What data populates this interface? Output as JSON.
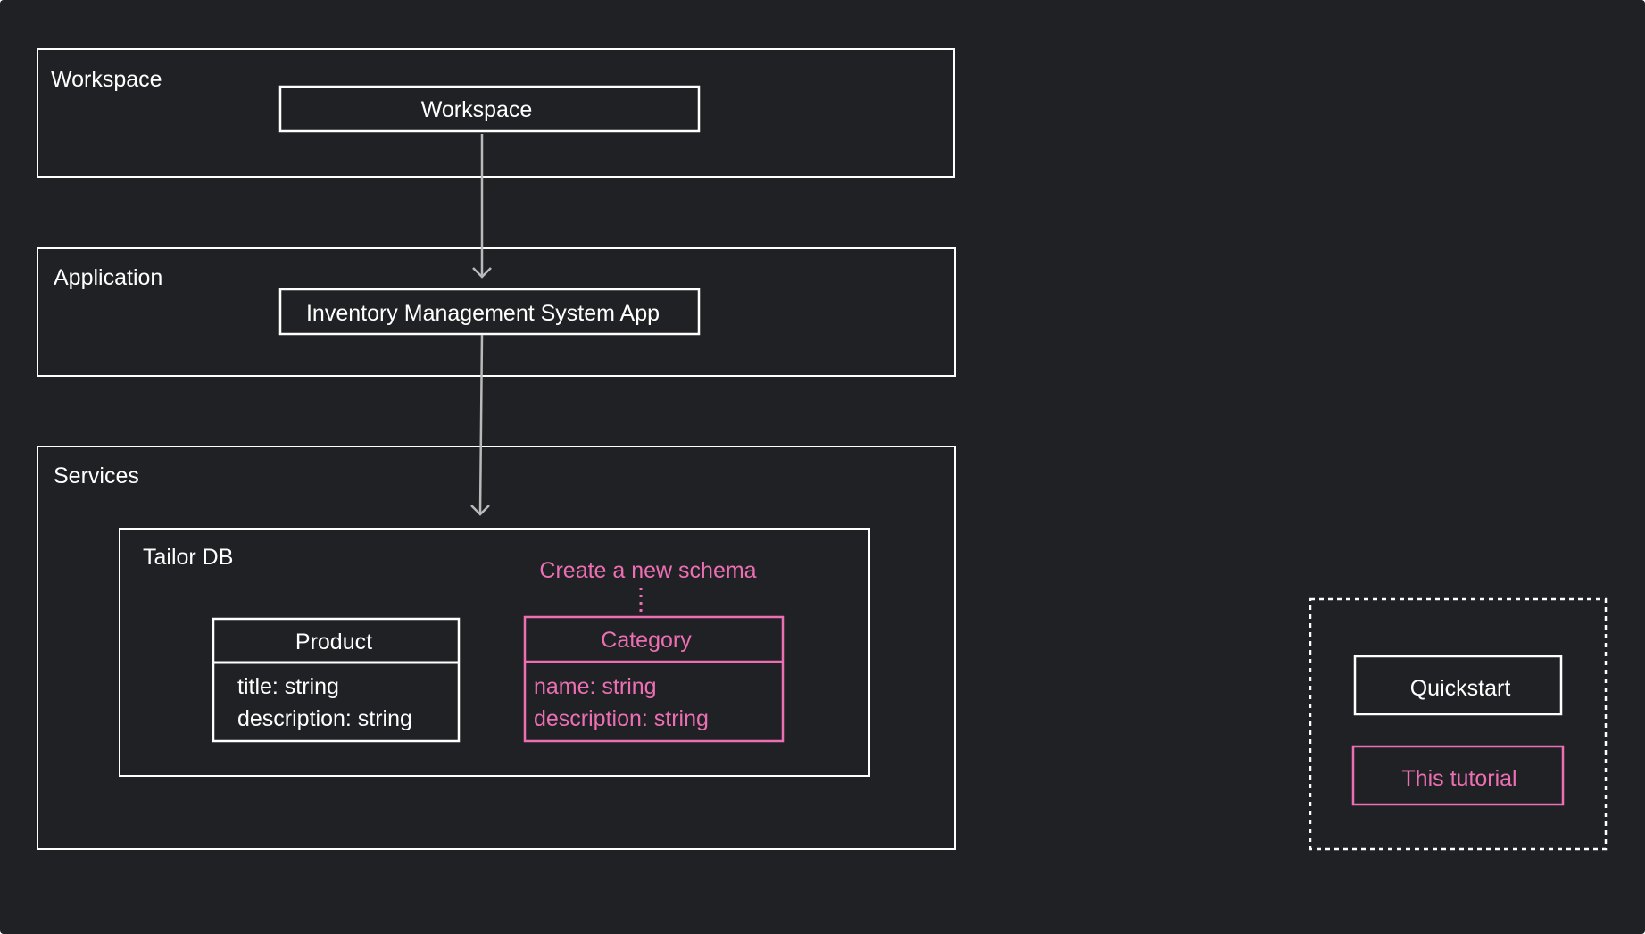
{
  "colors": {
    "background": "#202124",
    "stroke": "#ffffff",
    "text": "#ffffff",
    "accent": "#ec6fb3",
    "arrow": "#b9b9b9"
  },
  "groups": {
    "workspace": "Workspace",
    "application": "Application",
    "services": "Services"
  },
  "nodes": {
    "workspace": "Workspace",
    "app": "Inventory Management System App",
    "tailor_db": "Tailor DB"
  },
  "schemas": {
    "product": {
      "title": "Product",
      "fields": [
        "title: string",
        "description: string"
      ]
    },
    "category": {
      "title": "Category",
      "fields": [
        "name: string",
        "description: string"
      ],
      "annotation": "Create a new schema"
    }
  },
  "legend": {
    "quickstart": "Quickstart",
    "this_tutorial": "This tutorial"
  }
}
